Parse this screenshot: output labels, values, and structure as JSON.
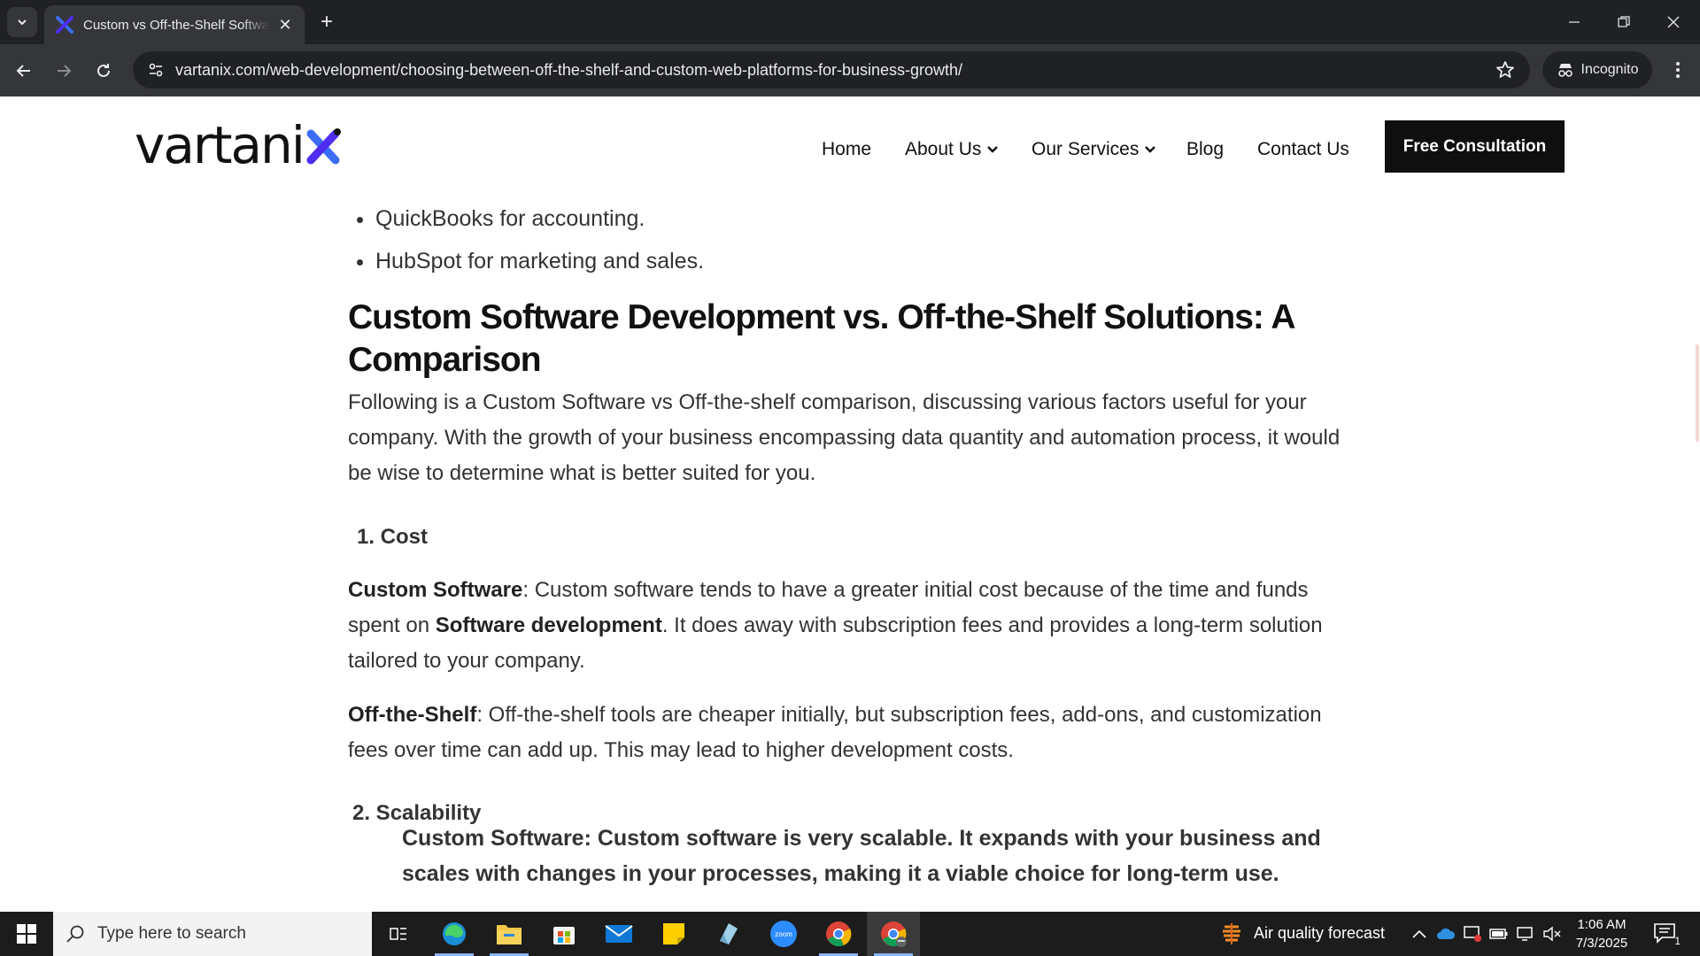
{
  "browser": {
    "tab_title": "Custom vs Off-the-Shelf Software Development",
    "url": "vartanix.com/web-development/choosing-between-off-the-shelf-and-custom-web-platforms-for-business-growth/",
    "incognito_label": "Incognito"
  },
  "site": {
    "logo_text": "vartani",
    "nav": {
      "home": "Home",
      "about": "About Us",
      "services": "Our Services",
      "blog": "Blog",
      "contact": "Contact Us"
    },
    "cta": "Free Consultation",
    "accent_color": "#4f2cf0"
  },
  "article": {
    "bullets": [
      "QuickBooks for accounting.",
      "HubSpot for marketing and sales."
    ],
    "heading": "Custom Software Development vs. Off-the-Shelf Solutions: A Comparison",
    "intro": "Following is a Custom Software vs Off-the-shelf comparison, discussing various factors useful for your company. With the growth of your business encompassing data quantity and automation process, it would be wise to determine what is better suited for you.",
    "section1_title": "1. Cost",
    "custom_label": "Custom Software",
    "custom_text_1": ": Custom software tends to have a greater initial cost because of the time and funds spent on ",
    "custom_link": "Software development",
    "custom_text_2": ". It does away with subscription fees and provides a long-term solution tailored to your company.",
    "ots_label": "Off-the-Shelf",
    "ots_text": ": Off-the-shelf tools are cheaper initially, but subscription fees, add-ons, and customization fees over time can add up. This may lead to higher development costs.",
    "section2_title": "2. Scalability",
    "scalability_text": "Custom Software: Custom software is very scalable. It expands with your business and scales with changes in your processes, making it a viable choice for long-term use."
  },
  "taskbar": {
    "search_placeholder": "Type here to search",
    "weather": "Air quality forecast",
    "time": "1:06 AM",
    "date": "7/3/2025",
    "notification_count": "1",
    "zoom_label": "zoom"
  }
}
